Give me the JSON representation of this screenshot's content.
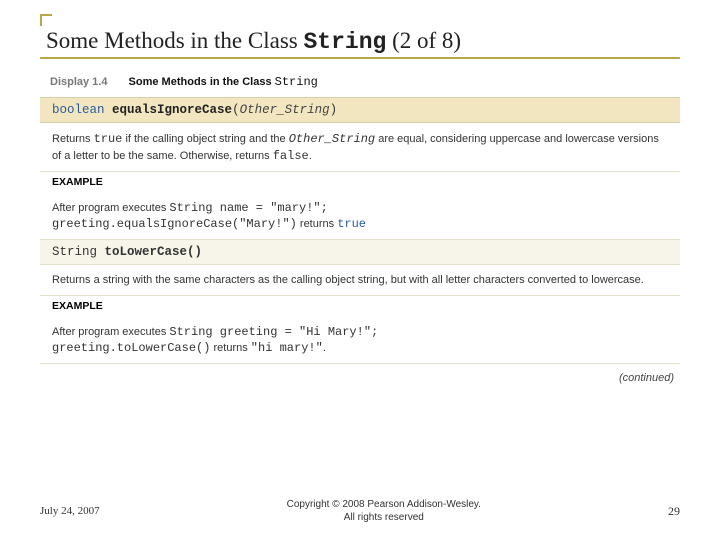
{
  "title": {
    "prefix": "Some Methods in the Class ",
    "mono": "String",
    "suffix": " (2 of 8)"
  },
  "display": {
    "label": "Display 1.4",
    "text": "Some Methods in the Class ",
    "mono": "String"
  },
  "method1": {
    "kw": "boolean",
    "name": "equalsIgnoreCase",
    "arg": "Other_String",
    "desc_a": "Returns ",
    "desc_true": "true",
    "desc_b": " if the calling object string and the ",
    "desc_arg": "Other_String",
    "desc_c": " are equal, considering uppercase and lowercase versions of a letter to be the same. Otherwise, returns ",
    "desc_false": "false",
    "desc_d": ".",
    "example_label": "EXAMPLE",
    "ex_a": "After program executes ",
    "ex_code1": "String name = \"mary!\";",
    "ex_code2": "greeting.equalsIgnoreCase(\"Mary!\")",
    "ex_b": " returns ",
    "ex_val": "true"
  },
  "method2": {
    "ret": "String",
    "name": "toLowerCase()",
    "desc": "Returns a string with the same characters as the calling object string, but with all letter characters converted to lowercase.",
    "example_label": "EXAMPLE",
    "ex_a": "After program executes ",
    "ex_code1": "String greeting = \"Hi Mary!\";",
    "ex_code2": "greeting.toLowerCase()",
    "ex_b": " returns ",
    "ex_val": "\"hi mary!\"",
    "ex_c": "."
  },
  "continued": "(continued)",
  "footer": {
    "date": "July 24, 2007",
    "copyright_l1": "Copyright © 2008 Pearson Addison-Wesley.",
    "copyright_l2": "All rights reserved",
    "page": "29"
  }
}
